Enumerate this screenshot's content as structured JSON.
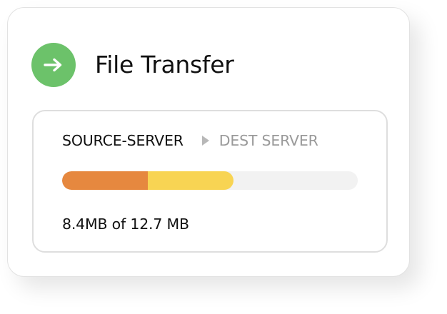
{
  "card": {
    "title": "File Transfer",
    "icon": "arrow-right-icon",
    "icon_color": "#6cc26a"
  },
  "transfer": {
    "source": "SOURCE-SERVER",
    "destination": "DEST SERVER",
    "route_icon": "caret-right-icon",
    "size_text": "8.4MB of 12.7 MB",
    "progress_fraction": 0.58,
    "progress_split_fraction": 0.5,
    "colors": {
      "segment_primary": "#e6883f",
      "segment_secondary": "#f8d453",
      "track": "#f2f2f2"
    }
  }
}
